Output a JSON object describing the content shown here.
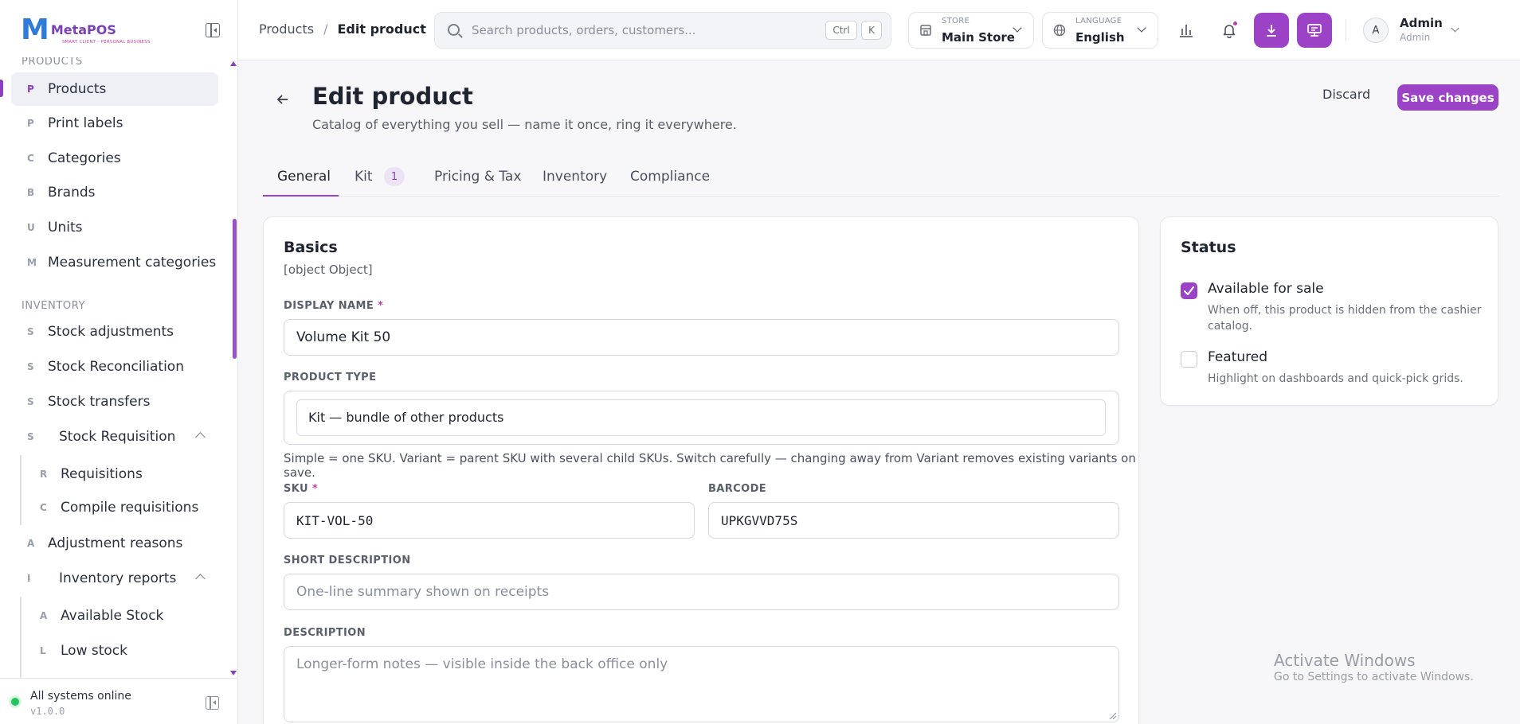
{
  "brand": {
    "name": "MetaPOS",
    "tagline": "SMART CLIENT - PERSONAL BUSINESS"
  },
  "sidebar": {
    "section_products_label": "PRODUCTS",
    "products_items": [
      {
        "letter": "P",
        "label": "Products",
        "active": true
      },
      {
        "letter": "P",
        "label": "Print labels"
      },
      {
        "letter": "C",
        "label": "Categories"
      },
      {
        "letter": "B",
        "label": "Brands"
      },
      {
        "letter": "U",
        "label": "Units"
      },
      {
        "letter": "M",
        "label": "Measurement categories"
      }
    ],
    "section_inventory_label": "INVENTORY",
    "inventory_items": [
      {
        "letter": "S",
        "label": "Stock adjustments"
      },
      {
        "letter": "S",
        "label": "Stock Reconciliation"
      },
      {
        "letter": "S",
        "label": "Stock transfers"
      },
      {
        "letter": "S",
        "label": "Stock Requisition"
      },
      {
        "letter": "R",
        "label": "Requisitions"
      },
      {
        "letter": "C",
        "label": "Compile requisitions"
      },
      {
        "letter": "A",
        "label": "Adjustment reasons"
      },
      {
        "letter": "I",
        "label": "Inventory reports"
      },
      {
        "letter": "A",
        "label": "Available Stock"
      },
      {
        "letter": "L",
        "label": "Low stock"
      }
    ],
    "footer": {
      "status": "All systems online",
      "version": "v1.0.0"
    }
  },
  "topbar": {
    "breadcrumb": {
      "parent": "Products",
      "separator": "/",
      "current": "Edit product"
    },
    "search": {
      "placeholder": "Search products, orders, customers...",
      "kbd_ctrl": "Ctrl",
      "kbd_k": "K"
    },
    "store": {
      "caption": "STORE",
      "value": "Main Store"
    },
    "language": {
      "caption": "LANGUAGE",
      "value": "English"
    },
    "user": {
      "initial": "A",
      "name": "Admin",
      "role": "Admin"
    }
  },
  "page": {
    "title": "Edit product",
    "subtitle": "Catalog of everything you sell — name it once, ring it everywhere.",
    "discard_label": "Discard",
    "save_label": "Save changes"
  },
  "tabs": [
    {
      "label": "General",
      "active": true
    },
    {
      "label": "Kit",
      "badge": "1"
    },
    {
      "label": "Pricing & Tax"
    },
    {
      "label": "Inventory"
    },
    {
      "label": "Compliance"
    }
  ],
  "basics": {
    "title": "Basics",
    "description": {
      "label": "DESCRIPTION",
      "placeholder": "Longer-form notes — visible inside the back office only",
      "value": ""
    },
    "display_name": {
      "label": "DISPLAY NAME",
      "required": "*",
      "value": "Volume Kit 50"
    },
    "product_type": {
      "label": "PRODUCT TYPE",
      "value": "Kit — bundle of other products",
      "helper": "Simple = one SKU. Variant = parent SKU with several child SKUs. Switch carefully — changing away from Variant removes existing variants on save."
    },
    "sku": {
      "label": "SKU",
      "required": "*",
      "value": "KIT-VOL-50"
    },
    "barcode": {
      "label": "BARCODE",
      "value": "UPKGVVD75S"
    },
    "short_description": {
      "label": "SHORT DESCRIPTION",
      "placeholder": "One-line summary shown on receipts",
      "value": ""
    }
  },
  "status": {
    "title": "Status",
    "available": {
      "label": "Available for sale",
      "checked": true,
      "description": "When off, this product is hidden from the cashier catalog."
    },
    "featured": {
      "label": "Featured",
      "checked": false,
      "description": "Highlight on dashboards and quick-pick grids."
    }
  },
  "watermark": {
    "title": "Activate Windows",
    "subtitle": "Go to Settings to activate Windows."
  },
  "colors": {
    "accent": "#9b42c7",
    "online": "#22c55e"
  }
}
